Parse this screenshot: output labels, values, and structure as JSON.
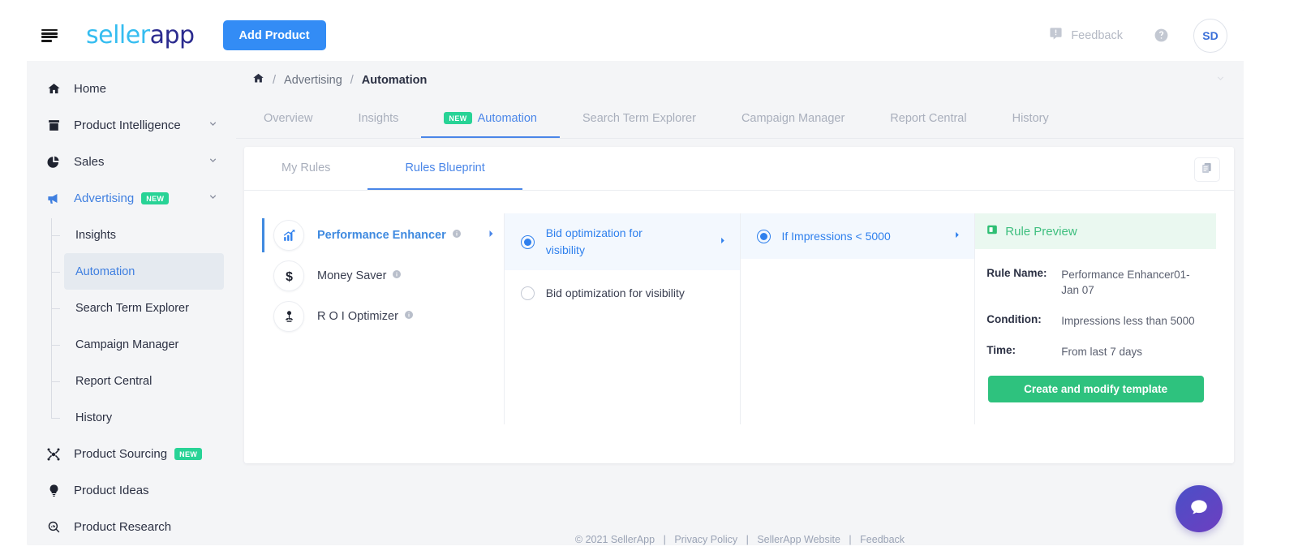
{
  "topbar": {
    "logo_seller": "seller",
    "logo_app": "app",
    "add_product": "Add Product",
    "feedback": "Feedback",
    "avatar_initials": "SD"
  },
  "sidebar": {
    "items": [
      {
        "label": "Home",
        "icon": "home-icon",
        "expandable": false,
        "badge": ""
      },
      {
        "label": "Product Intelligence",
        "icon": "archive-icon",
        "expandable": true,
        "badge": ""
      },
      {
        "label": "Sales",
        "icon": "pie-chart-icon",
        "expandable": true,
        "badge": ""
      },
      {
        "label": "Advertising",
        "icon": "megaphone-icon",
        "expandable": true,
        "badge": "NEW"
      }
    ],
    "advertising_children": [
      {
        "label": "Insights",
        "active": false
      },
      {
        "label": "Automation",
        "active": true
      },
      {
        "label": "Search Term Explorer",
        "active": false
      },
      {
        "label": "Campaign Manager",
        "active": false
      },
      {
        "label": "Report Central",
        "active": false
      },
      {
        "label": "History",
        "active": false
      }
    ],
    "bottom_items": [
      {
        "label": "Product Sourcing",
        "icon": "sourcing-icon",
        "badge": "NEW"
      },
      {
        "label": "Product Ideas",
        "icon": "bulb-icon",
        "badge": ""
      },
      {
        "label": "Product Research",
        "icon": "search-chart-icon",
        "badge": ""
      }
    ]
  },
  "breadcrumb": {
    "home_icon": "home-icon",
    "sep": "/",
    "level1": "Advertising",
    "level2": "Automation"
  },
  "tabs": [
    {
      "label": "Overview",
      "badge": "",
      "active": false
    },
    {
      "label": "Insights",
      "badge": "",
      "active": false
    },
    {
      "label": "Automation",
      "badge": "NEW",
      "active": true
    },
    {
      "label": "Search Term Explorer",
      "badge": "",
      "active": false
    },
    {
      "label": "Campaign Manager",
      "badge": "",
      "active": false
    },
    {
      "label": "Report Central",
      "badge": "",
      "active": false
    },
    {
      "label": "History",
      "badge": "",
      "active": false
    }
  ],
  "subtabs": [
    {
      "label": "My Rules",
      "active": false
    },
    {
      "label": "Rules Blueprint",
      "active": true
    }
  ],
  "blueprint": {
    "categories": [
      {
        "label": "Performance Enhancer",
        "icon": "trending-up-icon",
        "active": true,
        "has_info": true,
        "has_arrow": true
      },
      {
        "label": "Money Saver",
        "icon": "dollar-icon",
        "active": false,
        "has_info": true,
        "has_arrow": false
      },
      {
        "label": "R O I Optimizer",
        "icon": "seedling-icon",
        "active": false,
        "has_info": true,
        "has_arrow": false
      }
    ],
    "options": [
      {
        "label": "Bid optimization for visibility",
        "selected": true,
        "has_arrow": true
      },
      {
        "label": "Bid optimization for visibility",
        "selected": false,
        "has_arrow": false
      }
    ],
    "conditions": [
      {
        "label": "If Impressions < 5000",
        "selected": true,
        "has_arrow": true
      }
    ]
  },
  "preview": {
    "title": "Rule Preview",
    "icon": "preview-icon",
    "rows": [
      {
        "key": "Rule Name:",
        "value": "Performance Enhancer01-Jan 07"
      },
      {
        "key": "Condition:",
        "value": "Impressions less than 5000"
      },
      {
        "key": "Time:",
        "value": "From last 7 days"
      }
    ],
    "cta": "Create and modify template"
  },
  "footer": {
    "copyright": "© 2021 SellerApp",
    "links": [
      "Privacy Policy",
      "SellerApp Website",
      "Feedback"
    ],
    "sep": "|"
  },
  "chat": {
    "icon": "chat-bubble-icon"
  },
  "colors": {
    "accent_blue": "#3f8ae0",
    "button_blue": "#338cf5",
    "green": "#2ec27e",
    "badge_green": "#28d396",
    "logo_cyan": "#35bdf0",
    "logo_navy": "#2b2b8f"
  }
}
